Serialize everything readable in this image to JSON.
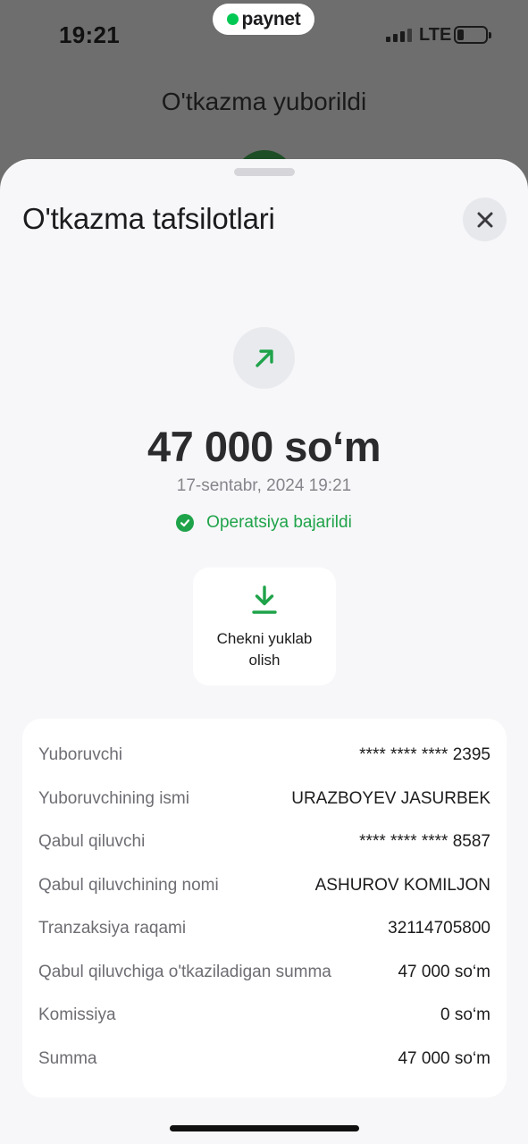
{
  "status_bar": {
    "time": "19:21",
    "network": "LTE",
    "battery_level": 0.2
  },
  "brand": {
    "name": "paynet",
    "dot_color": "#00c853"
  },
  "background_screen": {
    "title": "O'tkazma yuborildi"
  },
  "sheet": {
    "title": "O'tkazma tafsilotlari",
    "close_icon": "close-icon",
    "direction_icon": "arrow-up-right-icon",
    "amount": "47 000 so‘m",
    "date": "17-sentabr, 2024 19:21",
    "status": "Operatsiya bajarildi",
    "status_color": "#1fa34a",
    "download_icon": "download-icon",
    "download_label": "Chekni yuklab olish"
  },
  "details": [
    {
      "label": "Yuboruvchi",
      "value": "**** **** **** 2395"
    },
    {
      "label": "Yuboruvchining ismi",
      "value": "URAZBOYEV JASURBEK"
    },
    {
      "label": "Qabul qiluvchi",
      "value": "**** **** **** 8587"
    },
    {
      "label": "Qabul qiluvchining nomi",
      "value": "ASHUROV KOMILJON"
    },
    {
      "label": "Tranzaksiya raqami",
      "value": "32114705800"
    },
    {
      "label": "Qabul qiluvchiga o'tkaziladigan summa",
      "value": "47 000 so‘m"
    },
    {
      "label": "Komissiya",
      "value": "0 so‘m"
    },
    {
      "label": "Summa",
      "value": "47 000 so‘m"
    }
  ]
}
